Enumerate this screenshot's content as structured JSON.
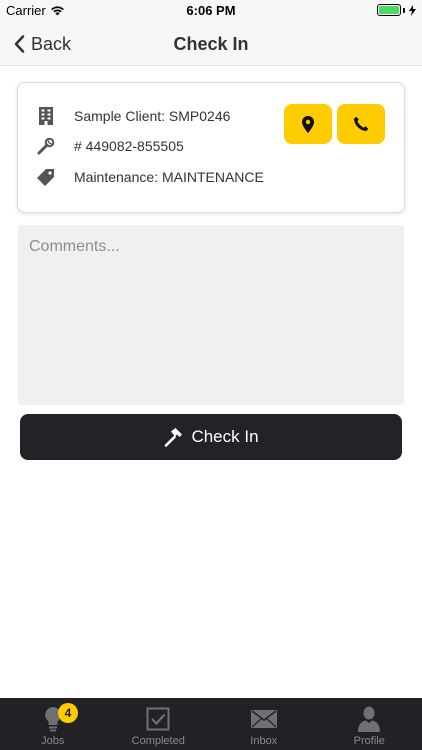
{
  "status_bar": {
    "carrier": "Carrier",
    "time": "6:06 PM",
    "battery_color": "#4cd964"
  },
  "nav": {
    "back_label": "Back",
    "title": "Check In"
  },
  "job_card": {
    "client": "Sample Client: SMP0246",
    "job_number": "# 449082-855505",
    "job_type": "Maintenance: MAINTENANCE",
    "row_icons": [
      "building-icon",
      "wrench-icon",
      "tag-icon"
    ],
    "actions": [
      {
        "icon": "map-pin-icon"
      },
      {
        "icon": "phone-icon"
      }
    ],
    "action_color": "#ffcc00"
  },
  "comments": {
    "placeholder": "Comments...",
    "value": ""
  },
  "checkin_button": {
    "label": "Check In",
    "icon": "hammer-icon",
    "color": "#222326"
  },
  "tab_bar": {
    "tabs": [
      {
        "label": "Jobs",
        "icon": "lightbulb-icon",
        "badge": "4"
      },
      {
        "label": "Completed",
        "icon": "checkbox-icon"
      },
      {
        "label": "Inbox",
        "icon": "envelope-icon"
      },
      {
        "label": "Profile",
        "icon": "person-icon"
      }
    ],
    "background": "#212226",
    "badge_color": "#ffcc00"
  }
}
